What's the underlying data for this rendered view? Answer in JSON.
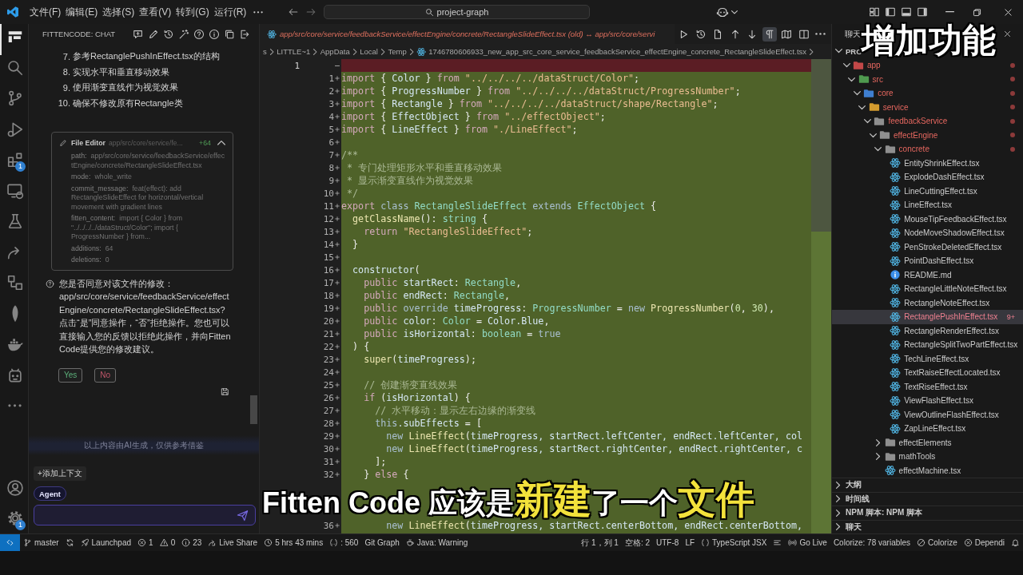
{
  "title_bar": {
    "menus": [
      "文件(F)",
      "编辑(E)",
      "选择(S)",
      "查看(V)",
      "转到(G)",
      "运行(R)"
    ],
    "search": "project-graph"
  },
  "activity_bar": {
    "items": [
      {
        "kind": "fitten",
        "selected": true
      },
      {
        "kind": "search",
        "selected": false
      },
      {
        "kind": "source-control",
        "selected": false
      },
      {
        "kind": "run-debug",
        "selected": false
      },
      {
        "kind": "extensions",
        "selected": false,
        "badge": "1"
      },
      {
        "kind": "remote-explorer",
        "selected": false
      },
      {
        "kind": "testing",
        "selected": false
      },
      {
        "kind": "live-share",
        "selected": false
      },
      {
        "kind": "graph",
        "selected": false
      },
      {
        "kind": "leaf",
        "selected": false
      },
      {
        "kind": "docker",
        "selected": false
      },
      {
        "kind": "robot",
        "selected": false
      },
      {
        "kind": "more",
        "selected": false
      }
    ],
    "bottom": [
      {
        "kind": "account"
      },
      {
        "kind": "settings",
        "badge": "1"
      }
    ]
  },
  "chat": {
    "title": "FITTENCODE: CHAT",
    "steps": [
      {
        "number": "7.",
        "text": "参考RectanglePushInEffect.tsx的结构"
      },
      {
        "number": "8.",
        "text": "实现水平和垂直移动效果"
      },
      {
        "number": "9.",
        "text": "使用渐变直线作为视觉效果"
      },
      {
        "number": "10.",
        "text": "确保不修改原有Rectangle类"
      }
    ],
    "file_card": {
      "title": "File Editor",
      "summary": "app/src/core/service/fe...",
      "additions": "+64",
      "expanded": true,
      "fields": [
        {
          "key": "path:",
          "value": "app/src/core/service/feedbackService/effectEngine/concrete/RectangleSlideEffect.tsx"
        },
        {
          "key": "mode:",
          "value": "whole_write"
        },
        {
          "key": "commit_message:",
          "value": "feat(effect): add RectangleSlideEffect for horizontal/vertical movement with gradient lines"
        },
        {
          "key": "fitten_content:",
          "value": "import { Color } from \"../../../../dataStruct/Color\"; import { ProgressNumber } from..."
        },
        {
          "key": "additions:",
          "value": "64"
        },
        {
          "key": "deletions:",
          "value": "0"
        }
      ]
    },
    "question": "您是否同意对该文件的修改：\napp/src/core/service/feedbackService/effectEngine/concrete/RectangleSlideEffect.tsx?\n点击“是”同意操作，“否”拒绝操作。您也可以直接输入您的反馈以拒绝此操作，并向Fitten Code提供您的修改建议。",
    "buttons": [
      {
        "kind": "accept",
        "label": "Yes"
      },
      {
        "kind": "reject",
        "label": "No"
      }
    ],
    "notice": "以上内容由AI生成，仅供参考借鉴",
    "add_context": "+添加上下文",
    "mode": "Agent"
  },
  "editor": {
    "tab_title": "app/src/core/service/feedbackService/effectEngine/concrete/RectangleSlideEffect.tsx (old) ↔ app/src/core/servi",
    "toolbar": [
      {
        "kind": "run",
        "selected": false
      },
      {
        "kind": "history",
        "selected": false
      },
      {
        "kind": "open-file",
        "selected": false
      },
      {
        "kind": "previous-change",
        "selected": false
      },
      {
        "kind": "next-change",
        "selected": false
      },
      {
        "kind": "whitespace",
        "selected": true
      },
      {
        "kind": "minimap",
        "selected": false
      },
      {
        "kind": "split",
        "selected": false
      },
      {
        "kind": "more",
        "selected": false
      }
    ],
    "breadcrumbs": [
      {
        "kind": "folder",
        "label": "s"
      },
      {
        "kind": "folder",
        "label": "LITTLE~1"
      },
      {
        "kind": "folder",
        "label": "AppData"
      },
      {
        "kind": "folder",
        "label": "Local"
      },
      {
        "kind": "folder",
        "label": "Temp"
      },
      {
        "kind": "tsx",
        "label": "1746780606933_new_app_src_core_service_feedbackService_effectEngine_concrete_RectangleSlideEffect.tsx"
      }
    ],
    "lines": [
      {
        "kind": "deleted",
        "old": "1"
      },
      {
        "kind": "added",
        "new": "1",
        "tokens": [
          {
            "kind": "keyword",
            "text": "import"
          },
          {
            "kind": "punct",
            "text": " { "
          },
          {
            "kind": "name",
            "text": "Color"
          },
          {
            "kind": "punct",
            "text": " } "
          },
          {
            "kind": "keyword",
            "text": "from"
          },
          {
            "kind": "string",
            "text": " \"../../../../dataStruct/Color\""
          },
          {
            "kind": "punct",
            "text": ";"
          }
        ]
      },
      {
        "kind": "added",
        "new": "2",
        "tokens": [
          {
            "kind": "keyword",
            "text": "import"
          },
          {
            "kind": "punct",
            "text": " { "
          },
          {
            "kind": "name",
            "text": "ProgressNumber"
          },
          {
            "kind": "punct",
            "text": " } "
          },
          {
            "kind": "keyword",
            "text": "from"
          },
          {
            "kind": "string",
            "text": " \"../../../../dataStruct/ProgressNumber\""
          },
          {
            "kind": "punct",
            "text": ";"
          }
        ]
      },
      {
        "kind": "added",
        "new": "3",
        "tokens": [
          {
            "kind": "keyword",
            "text": "import"
          },
          {
            "kind": "punct",
            "text": " { "
          },
          {
            "kind": "name",
            "text": "Rectangle"
          },
          {
            "kind": "punct",
            "text": " } "
          },
          {
            "kind": "keyword",
            "text": "from"
          },
          {
            "kind": "string",
            "text": " \"../../../../dataStruct/shape/Rectangle\""
          },
          {
            "kind": "punct",
            "text": ";"
          }
        ]
      },
      {
        "kind": "added",
        "new": "4",
        "tokens": [
          {
            "kind": "keyword",
            "text": "import"
          },
          {
            "kind": "punct",
            "text": " { "
          },
          {
            "kind": "name",
            "text": "EffectObject"
          },
          {
            "kind": "punct",
            "text": " } "
          },
          {
            "kind": "keyword",
            "text": "from"
          },
          {
            "kind": "string",
            "text": " \"../effectObject\""
          },
          {
            "kind": "punct",
            "text": ";"
          }
        ]
      },
      {
        "kind": "added",
        "new": "5",
        "tokens": [
          {
            "kind": "keyword",
            "text": "import"
          },
          {
            "kind": "punct",
            "text": " { "
          },
          {
            "kind": "name",
            "text": "LineEffect"
          },
          {
            "kind": "punct",
            "text": " } "
          },
          {
            "kind": "keyword",
            "text": "from"
          },
          {
            "kind": "string",
            "text": " \"./LineEffect\""
          },
          {
            "kind": "punct",
            "text": ";"
          }
        ]
      },
      {
        "kind": "added",
        "new": "6"
      },
      {
        "kind": "added",
        "new": "7",
        "tokens": [
          {
            "kind": "comment",
            "text": "/**"
          }
        ]
      },
      {
        "kind": "added",
        "new": "8",
        "tokens": [
          {
            "kind": "comment",
            "text": " * 专门处理矩形水平和垂直移动效果"
          }
        ]
      },
      {
        "kind": "added",
        "new": "9",
        "tokens": [
          {
            "kind": "comment",
            "text": " * 显示渐变直线作为视觉效果"
          }
        ]
      },
      {
        "kind": "added",
        "new": "10",
        "tokens": [
          {
            "kind": "comment",
            "text": " */"
          }
        ]
      },
      {
        "kind": "added",
        "new": "11",
        "tokens": [
          {
            "kind": "keyword",
            "text": "export"
          },
          {
            "kind": "storage",
            "text": " class"
          },
          {
            "kind": "type",
            "text": " RectangleSlideEffect"
          },
          {
            "kind": "storage",
            "text": " extends"
          },
          {
            "kind": "type",
            "text": " EffectObject"
          },
          {
            "kind": "punct",
            "text": " {"
          }
        ]
      },
      {
        "kind": "added",
        "new": "12",
        "tokens": [
          {
            "kind": "function",
            "text": "  getClassName"
          },
          {
            "kind": "punct",
            "text": "(): "
          },
          {
            "kind": "type",
            "text": "string"
          },
          {
            "kind": "punct",
            "text": " {"
          }
        ]
      },
      {
        "kind": "added",
        "new": "13",
        "tokens": [
          {
            "kind": "keyword",
            "text": "    return"
          },
          {
            "kind": "string",
            "text": " \"RectangleSlideEffect\""
          },
          {
            "kind": "punct",
            "text": ";"
          }
        ]
      },
      {
        "kind": "added",
        "new": "14",
        "tokens": [
          {
            "kind": "punct",
            "text": "  }"
          }
        ]
      },
      {
        "kind": "added",
        "new": "15"
      },
      {
        "kind": "added",
        "new": "16",
        "tokens": [
          {
            "kind": "name",
            "text": "  constructor"
          },
          {
            "kind": "punct",
            "text": "("
          }
        ]
      },
      {
        "kind": "added",
        "new": "17",
        "tokens": [
          {
            "kind": "keyword",
            "text": "    public"
          },
          {
            "kind": "name",
            "text": " startRect"
          },
          {
            "kind": "punct",
            "text": ": "
          },
          {
            "kind": "type",
            "text": "Rectangle"
          },
          {
            "kind": "punct",
            "text": ","
          }
        ]
      },
      {
        "kind": "added",
        "new": "18",
        "tokens": [
          {
            "kind": "keyword",
            "text": "    public"
          },
          {
            "kind": "name",
            "text": " endRect"
          },
          {
            "kind": "punct",
            "text": ": "
          },
          {
            "kind": "type",
            "text": "Rectangle"
          },
          {
            "kind": "punct",
            "text": ","
          }
        ]
      },
      {
        "kind": "added",
        "new": "19",
        "tokens": [
          {
            "kind": "keyword",
            "text": "    public"
          },
          {
            "kind": "storage",
            "text": " override"
          },
          {
            "kind": "name",
            "text": " timeProgress"
          },
          {
            "kind": "punct",
            "text": ": "
          },
          {
            "kind": "type",
            "text": "ProgressNumber"
          },
          {
            "kind": "punct",
            "text": " = "
          },
          {
            "kind": "storage",
            "text": "new"
          },
          {
            "kind": "function",
            "text": " ProgressNumber"
          },
          {
            "kind": "punct",
            "text": "("
          },
          {
            "kind": "number",
            "text": "0"
          },
          {
            "kind": "punct",
            "text": ", "
          },
          {
            "kind": "number",
            "text": "30"
          },
          {
            "kind": "punct",
            "text": "),"
          }
        ]
      },
      {
        "kind": "added",
        "new": "20",
        "tokens": [
          {
            "kind": "keyword",
            "text": "    public"
          },
          {
            "kind": "name",
            "text": " color"
          },
          {
            "kind": "punct",
            "text": ": "
          },
          {
            "kind": "type",
            "text": "Color"
          },
          {
            "kind": "punct",
            "text": " = "
          },
          {
            "kind": "name",
            "text": "Color.Blue"
          },
          {
            "kind": "punct",
            "text": ","
          }
        ]
      },
      {
        "kind": "added",
        "new": "21",
        "tokens": [
          {
            "kind": "keyword",
            "text": "    public"
          },
          {
            "kind": "name",
            "text": " isHorizontal"
          },
          {
            "kind": "punct",
            "text": ": "
          },
          {
            "kind": "type",
            "text": "boolean"
          },
          {
            "kind": "punct",
            "text": " = "
          },
          {
            "kind": "storage",
            "text": "true"
          }
        ]
      },
      {
        "kind": "added",
        "new": "22",
        "tokens": [
          {
            "kind": "punct",
            "text": "  ) {"
          }
        ]
      },
      {
        "kind": "added",
        "new": "23",
        "tokens": [
          {
            "kind": "function",
            "text": "    super"
          },
          {
            "kind": "punct",
            "text": "("
          },
          {
            "kind": "name",
            "text": "timeProgress"
          },
          {
            "kind": "punct",
            "text": ");"
          }
        ]
      },
      {
        "kind": "added",
        "new": "24"
      },
      {
        "kind": "added",
        "new": "25",
        "tokens": [
          {
            "kind": "comment",
            "text": "    // 创建渐变直线效果"
          }
        ]
      },
      {
        "kind": "added",
        "new": "26",
        "tokens": [
          {
            "kind": "keyword",
            "text": "    if"
          },
          {
            "kind": "punct",
            "text": " ("
          },
          {
            "kind": "name",
            "text": "isHorizontal"
          },
          {
            "kind": "punct",
            "text": ") {"
          }
        ]
      },
      {
        "kind": "added",
        "new": "27",
        "tokens": [
          {
            "kind": "comment",
            "text": "      // 水平移动：显示左右边缘的渐变线"
          }
        ]
      },
      {
        "kind": "added",
        "new": "28",
        "tokens": [
          {
            "kind": "storage",
            "text": "      this"
          },
          {
            "kind": "name",
            "text": ".subEffects"
          },
          {
            "kind": "punct",
            "text": " = ["
          }
        ]
      },
      {
        "kind": "added",
        "new": "29",
        "tokens": [
          {
            "kind": "storage",
            "text": "        new"
          },
          {
            "kind": "function",
            "text": " LineEffect"
          },
          {
            "kind": "punct",
            "text": "("
          },
          {
            "kind": "name",
            "text": "timeProgress, startRect.leftCenter, endRect.leftCenter, col"
          }
        ]
      },
      {
        "kind": "added",
        "new": "30",
        "tokens": [
          {
            "kind": "storage",
            "text": "        new"
          },
          {
            "kind": "function",
            "text": " LineEffect"
          },
          {
            "kind": "punct",
            "text": "("
          },
          {
            "kind": "name",
            "text": "timeProgress, startRect.rightCenter, endRect.rightCenter, c"
          }
        ]
      },
      {
        "kind": "added",
        "new": "31",
        "tokens": [
          {
            "kind": "punct",
            "text": "      ];"
          }
        ]
      },
      {
        "kind": "added",
        "new": "32",
        "tokens": [
          {
            "kind": "punct",
            "text": "    } "
          },
          {
            "kind": "keyword",
            "text": "else"
          },
          {
            "kind": "punct",
            "text": " {"
          }
        ]
      },
      {
        "kind": "added",
        "new": "36",
        "tokens": [
          {
            "kind": "storage",
            "text": "        new"
          },
          {
            "kind": "function",
            "text": " LineEffect"
          },
          {
            "kind": "punct",
            "text": "("
          },
          {
            "kind": "name",
            "text": "timeProgress, startRect.centerBottom, endRect.centerBottom,"
          }
        ]
      }
    ]
  },
  "explorer": {
    "title": "聊天",
    "section": "PRO",
    "tree": [
      {
        "name": "app",
        "kind": "folder",
        "color": "#c24848",
        "expanded": true,
        "modified": true,
        "selected": false,
        "children": [
          {
            "name": "src",
            "kind": "folder",
            "color": "#4f9a4f",
            "expanded": true,
            "modified": true,
            "selected": false,
            "children": [
              {
                "name": "core",
                "kind": "folder",
                "color": "#3f7fd0",
                "expanded": true,
                "modified": true,
                "selected": false,
                "children": [
                  {
                    "name": "service",
                    "kind": "folder",
                    "color": "#d49b2e",
                    "expanded": true,
                    "modified": true,
                    "selected": false,
                    "children": [
                      {
                        "name": "feedbackService",
                        "kind": "folder",
                        "color": "#8f8f8f",
                        "expanded": true,
                        "modified": true,
                        "selected": false,
                        "children": [
                          {
                            "name": "effectEngine",
                            "kind": "folder",
                            "color": "#8f8f8f",
                            "expanded": true,
                            "modified": true,
                            "selected": false,
                            "children": [
                              {
                                "name": "concrete",
                                "kind": "folder",
                                "color": "#8f8f8f",
                                "expanded": true,
                                "modified": true,
                                "selected": false,
                                "children": [
                                  {
                                    "name": "EntityShrinkEffect.tsx",
                                    "kind": "tsx",
                                    "modified": false,
                                    "selected": false
                                  },
                                  {
                                    "name": "ExplodeDashEffect.tsx",
                                    "kind": "tsx",
                                    "modified": false,
                                    "selected": false
                                  },
                                  {
                                    "name": "LineCuttingEffect.tsx",
                                    "kind": "tsx",
                                    "modified": false,
                                    "selected": false
                                  },
                                  {
                                    "name": "LineEffect.tsx",
                                    "kind": "tsx",
                                    "modified": false,
                                    "selected": false
                                  },
                                  {
                                    "name": "MouseTipFeedbackEffect.tsx",
                                    "kind": "tsx",
                                    "modified": false,
                                    "selected": false
                                  },
                                  {
                                    "name": "NodeMoveShadowEffect.tsx",
                                    "kind": "tsx",
                                    "modified": false,
                                    "selected": false
                                  },
                                  {
                                    "name": "PenStrokeDeletedEffect.tsx",
                                    "kind": "tsx",
                                    "modified": false,
                                    "selected": false
                                  },
                                  {
                                    "name": "PointDashEffect.tsx",
                                    "kind": "tsx",
                                    "modified": false,
                                    "selected": false
                                  },
                                  {
                                    "name": "README.md",
                                    "kind": "md",
                                    "modified": false,
                                    "selected": false
                                  },
                                  {
                                    "name": "RectangleLittleNoteEffect.tsx",
                                    "kind": "tsx",
                                    "modified": false,
                                    "selected": false
                                  },
                                  {
                                    "name": "RectangleNoteEffect.tsx",
                                    "kind": "tsx",
                                    "modified": false,
                                    "selected": false
                                  },
                                  {
                                    "name": "RectanglePushInEffect.tsx",
                                    "kind": "tsx",
                                    "modified": false,
                                    "selected": true,
                                    "badge": "9+"
                                  },
                                  {
                                    "name": "RectangleRenderEffect.tsx",
                                    "kind": "tsx",
                                    "modified": false,
                                    "selected": false
                                  },
                                  {
                                    "name": "RectangleSplitTwoPartEffect.tsx",
                                    "kind": "tsx",
                                    "modified": false,
                                    "selected": false
                                  },
                                  {
                                    "name": "TechLineEffect.tsx",
                                    "kind": "tsx",
                                    "modified": false,
                                    "selected": false
                                  },
                                  {
                                    "name": "TextRaiseEffectLocated.tsx",
                                    "kind": "tsx",
                                    "modified": false,
                                    "selected": false
                                  },
                                  {
                                    "name": "TextRiseEffect.tsx",
                                    "kind": "tsx",
                                    "modified": false,
                                    "selected": false
                                  },
                                  {
                                    "name": "ViewFlashEffect.tsx",
                                    "kind": "tsx",
                                    "modified": false,
                                    "selected": false
                                  },
                                  {
                                    "name": "ViewOutlineFlashEffect.tsx",
                                    "kind": "tsx",
                                    "modified": false,
                                    "selected": false
                                  },
                                  {
                                    "name": "ZapLineEffect.tsx",
                                    "kind": "tsx",
                                    "modified": false,
                                    "selected": false
                                  }
                                ]
                              },
                              {
                                "name": "effectElements",
                                "kind": "folder",
                                "color": "#8f8f8f",
                                "expanded": false,
                                "modified": false,
                                "selected": false
                              },
                              {
                                "name": "mathTools",
                                "kind": "folder",
                                "color": "#8f8f8f",
                                "expanded": false,
                                "modified": false,
                                "selected": false
                              },
                              {
                                "name": "effectMachine.tsx",
                                "kind": "tsx",
                                "modified": false,
                                "selected": false
                              }
                            ]
                          }
                        ]
                      }
                    ]
                  }
                ]
              }
            ]
          }
        ]
      }
    ],
    "panels": [
      "大纲",
      "时间线",
      "NPM 脚本: NPM 脚本",
      "聊天"
    ]
  },
  "status_bar": {
    "left": [
      {
        "kind": "remote"
      },
      {
        "kind": "branch",
        "text": "master"
      },
      {
        "kind": "sync"
      },
      {
        "kind": "launchpad",
        "text": "Launchpad"
      },
      {
        "kind": "errors",
        "text": "1"
      },
      {
        "kind": "warnings",
        "text": "0"
      },
      {
        "kind": "infos",
        "text": "23"
      },
      {
        "kind": "live-share",
        "text": "Live Share"
      },
      {
        "kind": "timer",
        "text": "5 hrs 43 mins"
      },
      {
        "kind": "braces",
        "text": ": 560"
      },
      {
        "kind": "plain",
        "text": "Git Graph"
      },
      {
        "kind": "java",
        "text": "Java: Warning"
      }
    ],
    "right": [
      {
        "kind": "plain",
        "text": "行 1，列 1"
      },
      {
        "kind": "plain",
        "text": "空格: 2"
      },
      {
        "kind": "plain",
        "text": "UTF-8"
      },
      {
        "kind": "plain",
        "text": "LF"
      },
      {
        "kind": "language",
        "text": "TypeScript JSX"
      },
      {
        "kind": "bars"
      },
      {
        "kind": "go-live",
        "text": "Go Live"
      },
      {
        "kind": "plain",
        "text": "Colorize: 78 variables"
      },
      {
        "kind": "colorize",
        "text": "Colorize"
      },
      {
        "kind": "dependi",
        "text": "Dependi"
      },
      {
        "kind": "bell"
      }
    ]
  },
  "video_overlays": {
    "caption": "增加功能",
    "subtitle": [
      {
        "text": "Fitten Code 应该是",
        "highlight": false
      },
      {
        "text": "新建",
        "highlight": true
      },
      {
        "text": "了一个",
        "highlight": false
      },
      {
        "text": "文件",
        "highlight": true
      }
    ]
  }
}
